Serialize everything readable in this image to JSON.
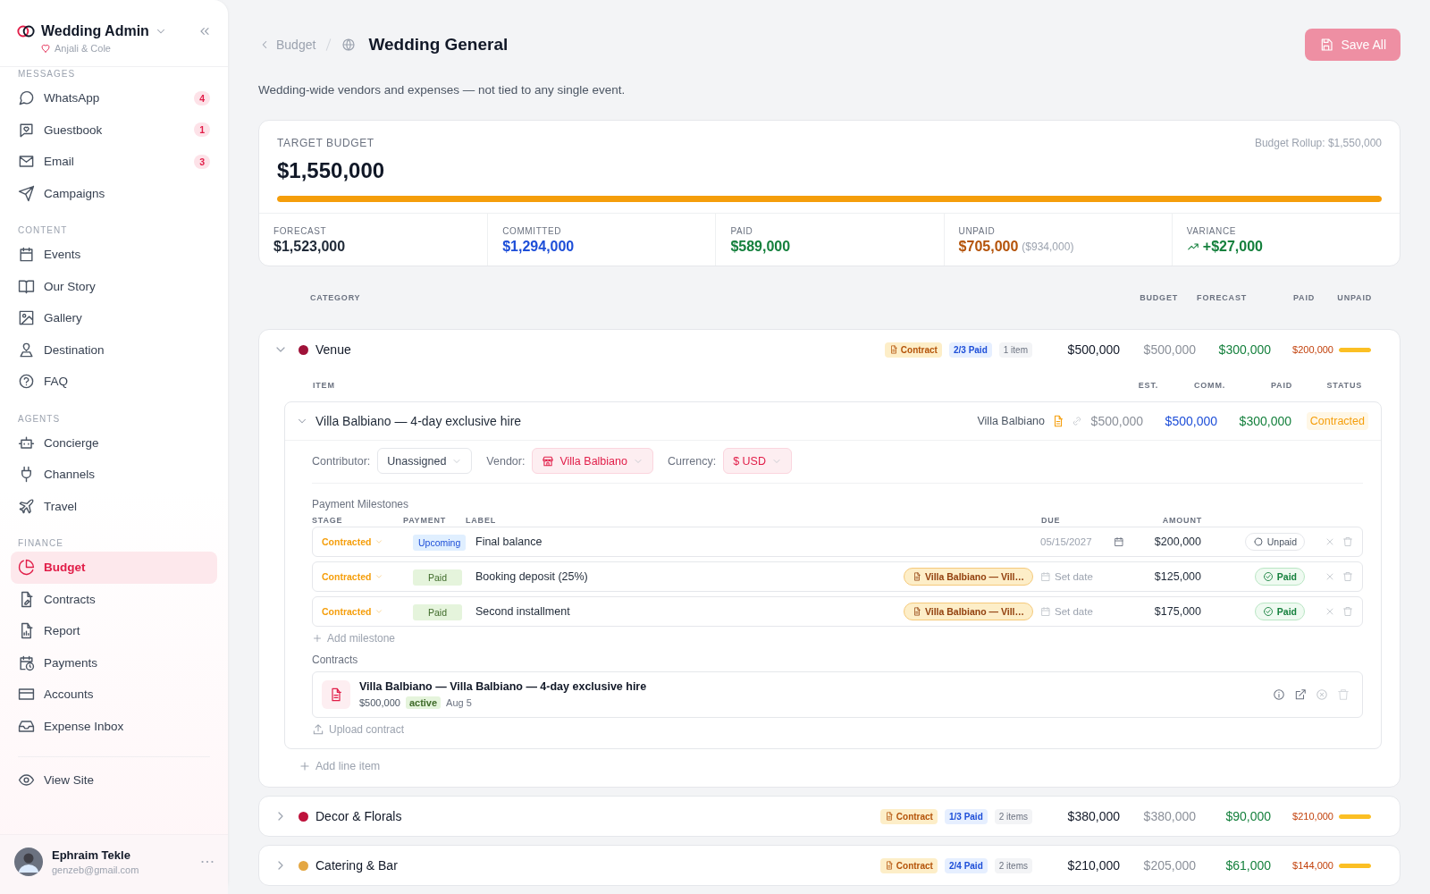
{
  "sidebar": {
    "app_name": "Wedding Admin",
    "couple": "Anjali & Cole",
    "sections": [
      {
        "title": "MESSAGES",
        "items": [
          {
            "label": "WhatsApp",
            "badge": "4",
            "selected": false
          },
          {
            "label": "Guestbook",
            "badge": "1",
            "selected": false
          },
          {
            "label": "Email",
            "badge": "3",
            "selected": false
          },
          {
            "label": "Campaigns",
            "selected": false
          }
        ]
      },
      {
        "title": "CONTENT",
        "items": [
          {
            "label": "Events",
            "selected": false
          },
          {
            "label": "Our Story",
            "selected": false
          },
          {
            "label": "Gallery",
            "selected": false
          },
          {
            "label": "Destination",
            "selected": false
          },
          {
            "label": "FAQ",
            "selected": false
          }
        ]
      },
      {
        "title": "AGENTS",
        "items": [
          {
            "label": "Concierge",
            "selected": false
          },
          {
            "label": "Channels",
            "selected": false
          },
          {
            "label": "Travel",
            "selected": false
          }
        ]
      },
      {
        "title": "FINANCE",
        "items": [
          {
            "label": "Budget",
            "selected": true
          },
          {
            "label": "Contracts",
            "selected": false
          },
          {
            "label": "Report",
            "selected": false
          },
          {
            "label": "Payments",
            "selected": false
          },
          {
            "label": "Accounts",
            "selected": false
          },
          {
            "label": "Expense Inbox",
            "selected": false
          }
        ]
      }
    ],
    "view_site": "View Site",
    "user": {
      "name": "Ephraim Tekle",
      "email": "genzeb@gmail.com"
    }
  },
  "header": {
    "breadcrumb": "Budget",
    "title": "Wedding General",
    "save_button": "Save All",
    "description": "Wedding-wide vendors and expenses — not tied to any single event."
  },
  "summary": {
    "label": "TARGET BUDGET",
    "amount": "$1,550,000",
    "rollup": "Budget Rollup: $1,550,000",
    "level": 1,
    "stats": [
      {
        "label": "FORECAST",
        "value": "$1,523,000",
        "color": "#1f2937"
      },
      {
        "label": "COMMITTED",
        "value": "$1,294,000",
        "color": "#1d4ed8"
      },
      {
        "label": "PAID",
        "value": "$589,000",
        "color": "#15803d"
      },
      {
        "label": "UNPAID",
        "value": "$705,000",
        "note": "($934,000)",
        "color": "#b45309"
      },
      {
        "label": "VARIANCE",
        "value": "+$27,000",
        "rising": true,
        "color": "#15803d"
      }
    ]
  },
  "category_columns": [
    "CATEGORY",
    "BUDGET",
    "FORECAST",
    "PAID",
    "UNPAID"
  ],
  "categories": [
    {
      "name": "Venue",
      "color": "#9f1239",
      "expanded": true,
      "contract_tag": "Contract",
      "paid_tag": "2/3 Paid",
      "items_tag": "1 item",
      "budget": "$500,000",
      "forecast": "$500,000",
      "paid": "$300,000",
      "unpaid": "$200,000",
      "level": 1,
      "item_columns": [
        "ITEM",
        "EST.",
        "COMM.",
        "PAID",
        "STATUS"
      ],
      "line_items": [
        {
          "title": "Villa Balbiano — 4-day exclusive hire",
          "expanded": true,
          "vendor": "Villa Balbiano",
          "est": "$500,000",
          "comm": "$500,000",
          "paid": "$300,000",
          "status": "Contracted",
          "fields": [
            {
              "label": "Contributor:",
              "value": "Unassigned",
              "kind": "plain"
            },
            {
              "label": "Vendor:",
              "value": "Villa Balbiano",
              "kind": "vendor"
            },
            {
              "label": "Currency:",
              "value": "$ USD",
              "kind": "currency"
            }
          ],
          "milestones_title": "Payment Milestones",
          "milestone_columns": [
            "STAGE",
            "PAYMENT",
            "LABEL",
            "DUE",
            "AMOUNT"
          ],
          "milestones": [
            {
              "stage": "Contracted",
              "payment": "Upcoming",
              "label": "Final balance",
              "due": "05/15/2027",
              "amount": "$200,000",
              "status": "Unpaid",
              "paid": false
            },
            {
              "stage": "Contracted",
              "payment": "Paid",
              "label": "Booking deposit (25%)",
              "contract": "Villa Balbiano — Vill…",
              "due_placeholder": "Set date",
              "amount": "$125,000",
              "status": "Paid",
              "paid": true
            },
            {
              "stage": "Contracted",
              "payment": "Paid",
              "label": "Second installment",
              "contract": "Villa Balbiano — Vill…",
              "due_placeholder": "Set date",
              "amount": "$175,000",
              "status": "Paid",
              "paid": true
            }
          ],
          "add_milestone": "Add milestone",
          "contracts_title": "Contracts",
          "contracts": [
            {
              "title": "Villa Balbiano — Villa Balbiano — 4-day exclusive hire",
              "amount": "$500,000",
              "status": "active",
              "date": "Aug 5"
            }
          ],
          "upload": "Upload contract"
        }
      ],
      "add_line_item": "Add line item"
    },
    {
      "name": "Decor & Florals",
      "color": "#be123c",
      "expanded": false,
      "contract_tag": "Contract",
      "paid_tag": "1/3 Paid",
      "items_tag": "2 items",
      "budget": "$380,000",
      "forecast": "$380,000",
      "paid": "$90,000",
      "unpaid": "$210,000",
      "level": 1
    },
    {
      "name": "Catering & Bar",
      "color": "#e4a743",
      "expanded": false,
      "contract_tag": "Contract",
      "paid_tag": "2/4 Paid",
      "items_tag": "2 items",
      "budget": "$210,000",
      "forecast": "$205,000",
      "paid": "$61,000",
      "unpaid": "$144,000",
      "level": 1
    }
  ]
}
